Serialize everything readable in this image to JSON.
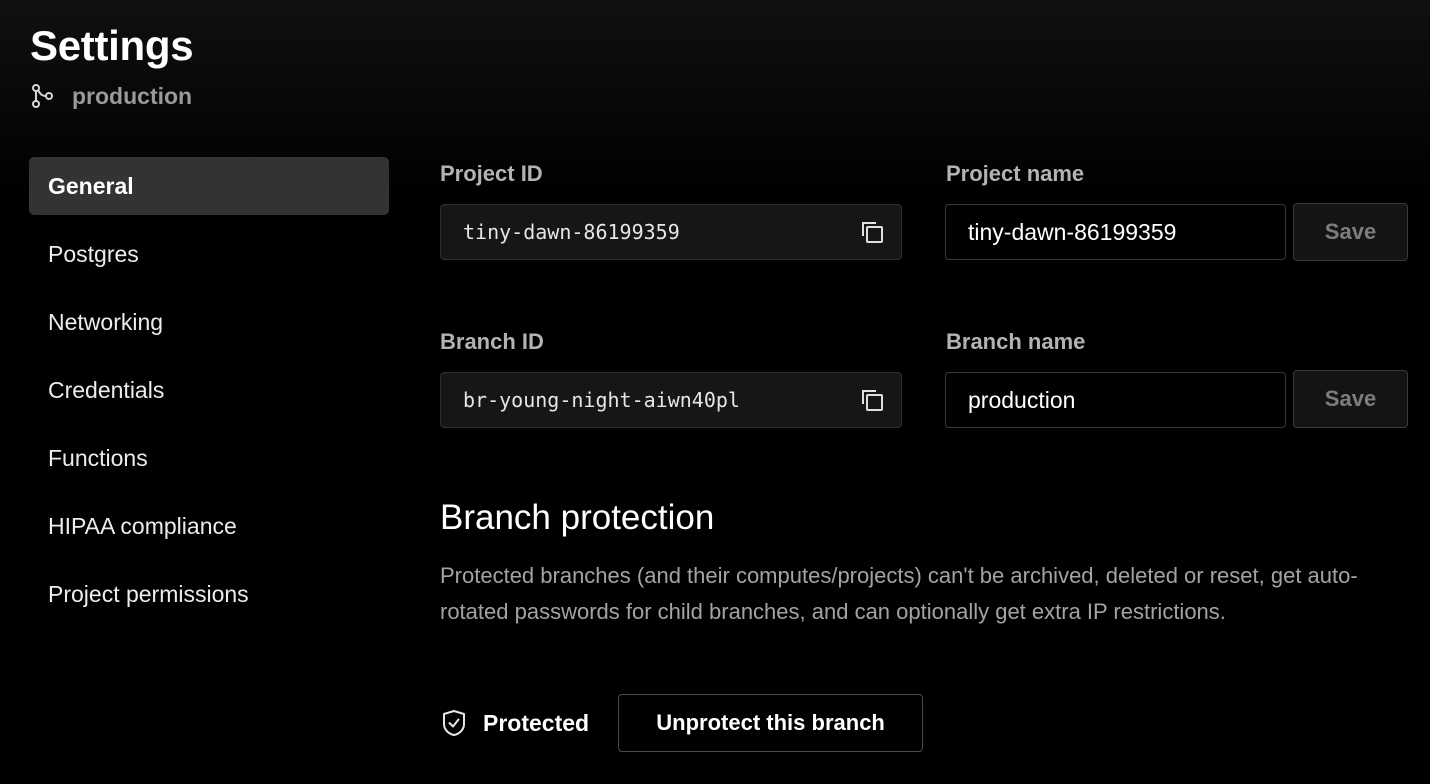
{
  "header": {
    "title": "Settings",
    "branch_icon": "branch-icon",
    "branch_name": "production"
  },
  "sidebar": {
    "items": [
      {
        "label": "General",
        "active": true
      },
      {
        "label": "Postgres",
        "active": false
      },
      {
        "label": "Networking",
        "active": false
      },
      {
        "label": "Credentials",
        "active": false
      },
      {
        "label": "Functions",
        "active": false
      },
      {
        "label": "HIPAA compliance",
        "active": false
      },
      {
        "label": "Project permissions",
        "active": false
      }
    ]
  },
  "general": {
    "project_id": {
      "label": "Project ID",
      "value": "tiny-dawn-86199359",
      "copy_icon": "copy-icon"
    },
    "project_name": {
      "label": "Project name",
      "value": "tiny-dawn-86199359",
      "save_label": "Save"
    },
    "branch_id": {
      "label": "Branch ID",
      "value": "br-young-night-aiwn40pl",
      "copy_icon": "copy-icon"
    },
    "branch_name": {
      "label": "Branch name",
      "value": "production",
      "save_label": "Save"
    }
  },
  "branch_protection": {
    "title": "Branch protection",
    "description": "Protected branches (and their computes/projects) can't be archived, deleted or reset, get auto-rotated passwords for child branches, and can optionally get extra IP restrictions.",
    "status_icon": "shield-check-icon",
    "status": "Protected",
    "unprotect_label": "Unprotect this branch"
  },
  "colors": {
    "background": "#000000",
    "active_nav": "#333333",
    "muted_text": "#a3a3a3"
  }
}
